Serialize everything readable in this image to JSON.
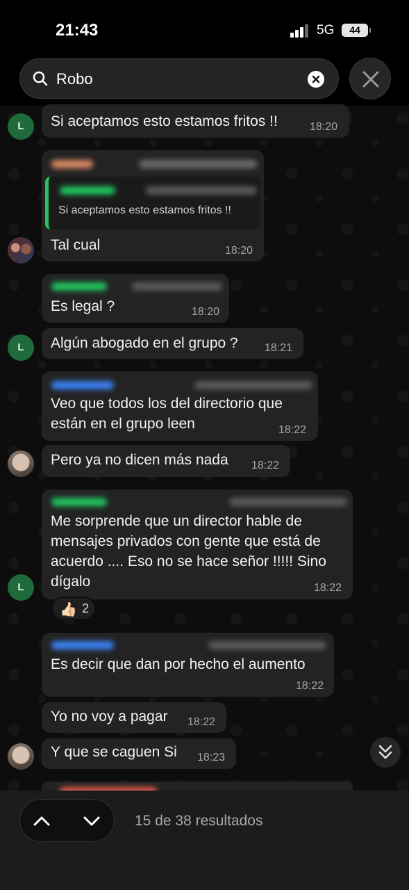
{
  "status_bar": {
    "time": "21:43",
    "network": "5G",
    "battery": "44"
  },
  "search": {
    "query": "Robo"
  },
  "messages": [
    {
      "text": "Si aceptamos esto estamos fritos !!",
      "time": "18:20",
      "avatar": "L"
    },
    {
      "quote": "Si aceptamos esto estamos fritos !!",
      "text": "Tal cual",
      "time": "18:20"
    },
    {
      "text": "Es legal ?",
      "time": "18:20"
    },
    {
      "text": "Algún abogado en el grupo ?",
      "time": "18:21",
      "avatar": "L"
    },
    {
      "lines": [
        "Veo que todos los del directorio que",
        "están en el grupo leen"
      ],
      "time": "18:22"
    },
    {
      "text": "Pero ya no dicen más nada",
      "time": "18:22"
    },
    {
      "lines": [
        "Me sorprende que un director hable de",
        "mensajes privados con gente que está de",
        "acuerdo .... Eso no se hace señor !!!!! Sino",
        "dígalo"
      ],
      "time": "18:22",
      "avatar": "L",
      "reaction": {
        "emoji": "👍🏻",
        "count": "2"
      }
    },
    {
      "text": "Es decir que dan por hecho el aumento",
      "time": "18:22"
    },
    {
      "text": "Yo no voy a pagar",
      "time": "18:22"
    },
    {
      "text": "Y que se caguen Si",
      "time": "18:23"
    }
  ],
  "footer": {
    "results": "15 de 38 resultados"
  },
  "colors": {
    "accent_green": "#22c55e",
    "bubble": "#232323",
    "background": "#0b0b0b"
  }
}
